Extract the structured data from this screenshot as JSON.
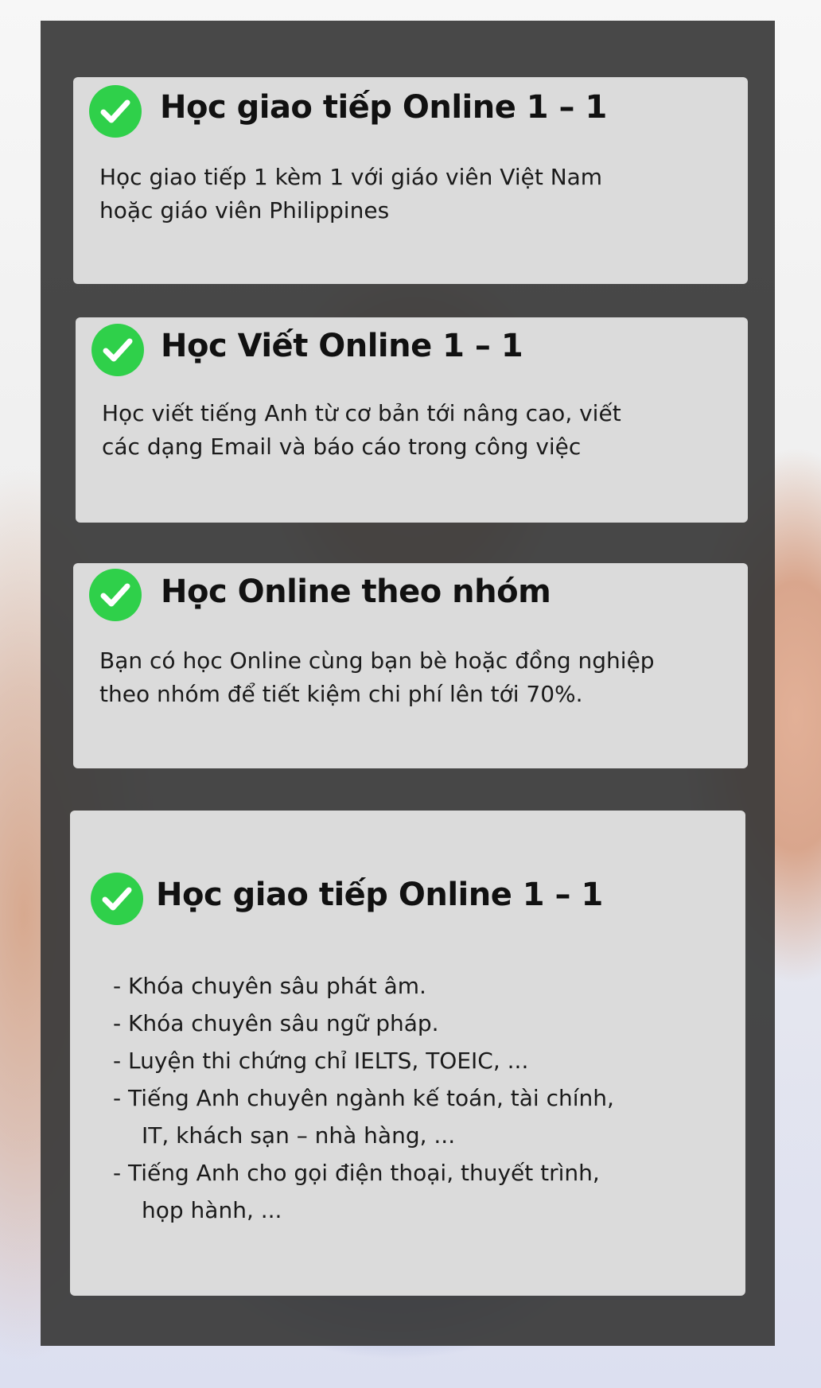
{
  "cards": [
    {
      "title": "Học giao tiếp Online 1 – 1",
      "desc_lines": [
        "Học giao tiếp 1 kèm 1 với giáo viên Việt Nam",
        "hoặc giáo viên Philippines"
      ]
    },
    {
      "title": "Học Viết Online 1 – 1",
      "desc_lines": [
        "Học viết tiếng Anh từ cơ bản tới nâng cao, viết",
        "các dạng Email và báo cáo trong công việc"
      ]
    },
    {
      "title": "Học Online theo nhóm",
      "desc_lines": [
        "Bạn có học Online cùng bạn bè hoặc đồng nghiệp",
        "theo nhóm để tiết kiệm chi phí lên tới 70%."
      ]
    },
    {
      "title": "Học giao tiếp Online 1 – 1",
      "list_lines": [
        "- Khóa chuyên sâu phát âm.",
        "- Khóa chuyên sâu ngữ pháp.",
        "- Luyện thi chứng chỉ IELTS, TOEIC, ...",
        "- Tiếng Anh chuyên ngành kế toán, tài chính,",
        "IT, khách sạn – nhà hàng, ...",
        "- Tiếng Anh cho gọi điện thoại, thuyết trình,",
        "họp hành, ..."
      ]
    }
  ],
  "icon": "check-circle-icon",
  "colors": {
    "check": "#2fd04a",
    "panel": "#3a3a3a",
    "card": "#e8e8e8"
  }
}
